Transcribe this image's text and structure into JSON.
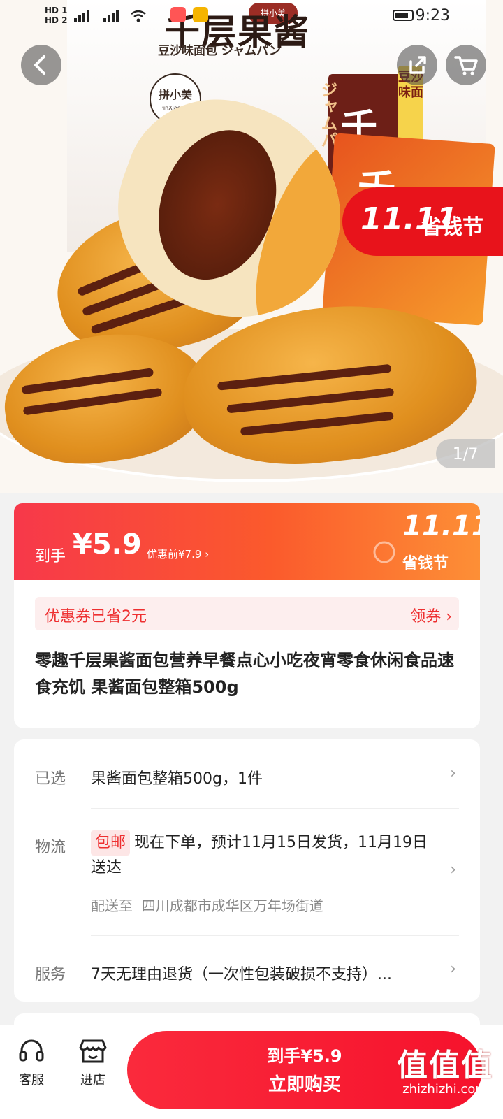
{
  "status": {
    "hd_top": "HD 1",
    "hd_bottom": "HD 2",
    "time": "9:23"
  },
  "hero": {
    "box_title": "千层果酱",
    "box_subtitle": "豆沙味面包 ジャムパン",
    "brand_cn": "拼小美",
    "brand_en": "PinXiaoMei",
    "label_vertical": "豆沙味面",
    "label_ja": "ジャムパ",
    "label_big": "千层",
    "packet_char": "千",
    "festival_number": "11.11",
    "festival_text": "省钱节",
    "pager_current": "1",
    "pager_total": "/7"
  },
  "price": {
    "label": "到手",
    "value": "¥5.9",
    "original": "优惠前¥7.9",
    "chevron": "›",
    "badge_number": "11.11",
    "badge_text": "省钱节"
  },
  "coupon": {
    "text": "优惠券已省2元",
    "action": "领券 ›"
  },
  "product": {
    "title": "零趣千层果酱面包营养早餐点心小吃夜宵零食休闲食品速食充饥 果酱面包整箱500g"
  },
  "selected": {
    "label": "已选",
    "value": "果酱面包整箱500g，1件"
  },
  "shipping": {
    "label": "物流",
    "tag": "包邮",
    "text": "现在下单，预计11月15日发货，11月19日送达",
    "address_label": "配送至",
    "address": "四川成都市成华区万年场街道"
  },
  "service": {
    "label": "服务",
    "value": "7天无理由退货（一次性包装破损不支持）..."
  },
  "bottom_bar": {
    "service_label": "客服",
    "store_label": "进店",
    "buy_price": "到手¥5.9",
    "buy_label": "立即购买"
  },
  "watermark": {
    "text": "值值值",
    "url": "zhizhizhi.com"
  },
  "colors": {
    "accent": "#f6122c",
    "coupon_bg": "#fdeeee",
    "price_gradient_end": "#fd8f36"
  }
}
